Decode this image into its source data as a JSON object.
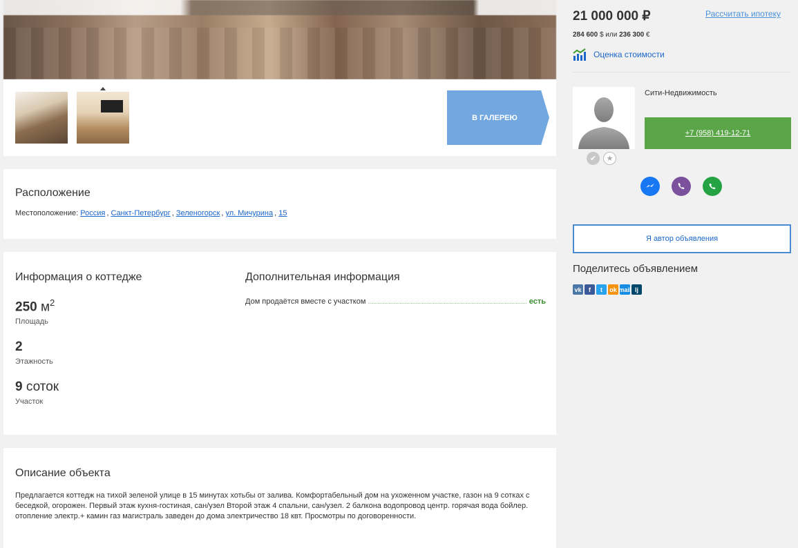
{
  "gallery": {
    "button_label": "В ГАЛЕРЕЮ"
  },
  "location": {
    "title": "Расположение",
    "label": "Местоположение:",
    "links": [
      "Россия",
      "Санкт-Петербург",
      "Зеленогорск",
      "ул. Мичурина",
      "15"
    ]
  },
  "cottage_info": {
    "title": "Информация о коттедже",
    "area_value": "250",
    "area_unit": "м",
    "area_unit_sup": "2",
    "area_label": "Площадь",
    "floors_value": "2",
    "floors_label": "Этажность",
    "plot_value": "9",
    "plot_unit": "соток",
    "plot_label": "Участок"
  },
  "extra_info": {
    "title": "Дополнительная информация",
    "row_label": "Дом продаётся вместе с участком",
    "row_value": "есть"
  },
  "description": {
    "title": "Описание объекта",
    "text": "Предлагается коттедж на тихой зеленой улице в 15 минутах хотьбы от залива. Комфортабельный дом на ухоженном участке, газон на 9 сотках с беседкой, огорожен. Первый этаж кухня-гостиная, сан/узел Второй этаж 4 спальни, сан/узел. 2 балкона водопровод центр. горячая вода бойлер. отопление электр.+ камин газ магистраль заведен до дома электричество 18 квт. Просмотры по договоренности."
  },
  "sidebar": {
    "price": "21 000 000 ₽",
    "mortgage_link": "Рассчитать ипотеку",
    "price_usd": "284 600",
    "usd_sign": "$",
    "or_text": "или",
    "price_eur": "236 300",
    "eur_sign": "€",
    "estimate_link": "Оценка стоимости",
    "agency": "Сити-Недвижимость",
    "phone": "+7 (958) 419-12-71",
    "author_button": "Я автор объявления",
    "share_title": "Поделитесь объявлением",
    "share_buttons": [
      "vk",
      "f",
      "t",
      "ok",
      "mail",
      "lj"
    ]
  },
  "colors": {
    "accent": "#1a66c9",
    "phone_green": "#5aa547",
    "gallery_blue": "#72a7e0",
    "messenger": "#1877f2",
    "viber": "#7b519d",
    "whatsapp": "#25a244"
  }
}
